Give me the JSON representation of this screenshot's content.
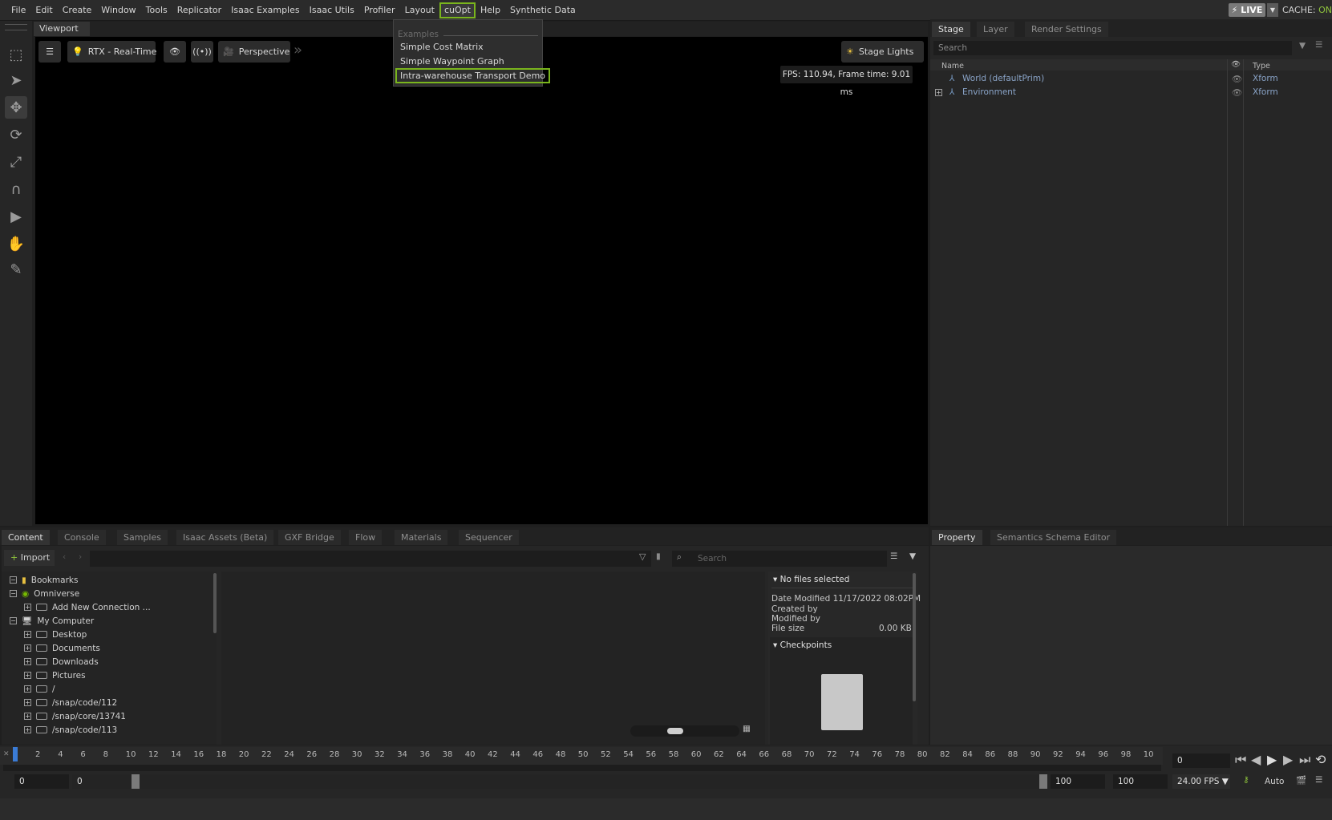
{
  "menubar": {
    "items": [
      "File",
      "Edit",
      "Create",
      "Window",
      "Tools",
      "Replicator",
      "Isaac Examples",
      "Isaac Utils",
      "Profiler",
      "Layout",
      "cuOpt",
      "Help",
      "Synthetic Data"
    ],
    "active": "cuOpt",
    "live_label": "LIVE",
    "cache_label": "CACHE:",
    "cache_state": "ON"
  },
  "dropdown": {
    "header": "Examples",
    "items": [
      "Simple Cost Matrix",
      "Simple Waypoint Graph",
      "Intra-warehouse Transport Demo"
    ],
    "selected": "Intra-warehouse Transport Demo"
  },
  "viewport": {
    "tab": "Viewport",
    "render_mode": "RTX - Real-Time",
    "camera": "Perspective",
    "lights": "Stage Lights",
    "fps_text": "FPS: 110.94, Frame time: 9.01 ms"
  },
  "stage": {
    "tabs": [
      "Stage",
      "Layer",
      "Render Settings"
    ],
    "search_placeholder": "Search",
    "col_name": "Name",
    "col_type": "Type",
    "rows": [
      {
        "name": "World (defaultPrim)",
        "type": "Xform"
      },
      {
        "name": "Environment",
        "type": "Xform"
      }
    ]
  },
  "content": {
    "tabs": [
      "Content",
      "Console",
      "Samples",
      "Isaac Assets (Beta)",
      "GXF Bridge",
      "Flow",
      "Materials",
      "Sequencer"
    ],
    "import_label": "Import",
    "search_placeholder": "Search",
    "tree": [
      "Bookmarks",
      "Omniverse",
      "Add New Connection ...",
      "My Computer",
      "Desktop",
      "Documents",
      "Downloads",
      "Pictures",
      "/",
      "/snap/code/112",
      "/snap/core/13741",
      "/snap/code/113"
    ],
    "details": {
      "header": "No files selected",
      "date_modified_label": "Date Modified",
      "date_modified": "11/17/2022 08:02PM",
      "created_by_label": "Created by",
      "modified_by_label": "Modified by",
      "file_size_label": "File size",
      "file_size": "0.00 KB",
      "checkpoints": "Checkpoints"
    }
  },
  "property": {
    "tabs": [
      "Property",
      "Semantics Schema Editor"
    ]
  },
  "timeline": {
    "ticks": [
      "2",
      "4",
      "6",
      "8",
      "10",
      "12",
      "14",
      "16",
      "18",
      "20",
      "22",
      "24",
      "26",
      "28",
      "30",
      "32",
      "34",
      "36",
      "38",
      "40",
      "42",
      "44",
      "46",
      "48",
      "50",
      "52",
      "54",
      "56",
      "58",
      "60",
      "62",
      "64",
      "66",
      "68",
      "70",
      "72",
      "74",
      "76",
      "78",
      "80",
      "82",
      "84",
      "86",
      "88",
      "90",
      "92",
      "94",
      "96",
      "98",
      "10"
    ],
    "current_frame": "0",
    "start": "0",
    "start2": "0",
    "end": "100",
    "end2": "100",
    "fps": "24.00 FPS",
    "auto": "Auto"
  }
}
